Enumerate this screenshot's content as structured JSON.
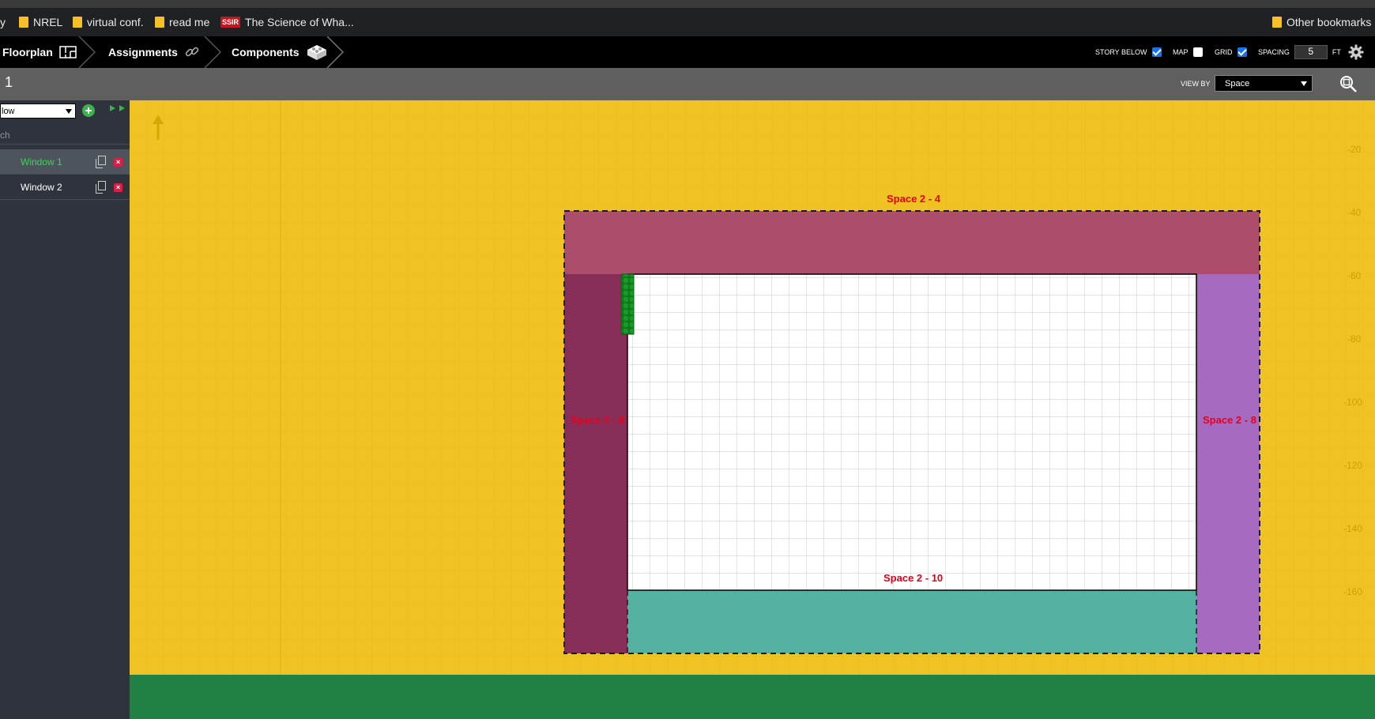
{
  "bookmarks": {
    "items": [
      {
        "label": "y"
      },
      {
        "label": "NREL"
      },
      {
        "label": "virtual conf."
      },
      {
        "label": "read me"
      },
      {
        "label": "The Science of Wha..."
      }
    ],
    "other": "Other bookmarks"
  },
  "toolbar": {
    "tabs": [
      {
        "label": "Floorplan",
        "icon": "floorplan-icon"
      },
      {
        "label": "Assignments",
        "icon": "link-icon"
      },
      {
        "label": "Components",
        "icon": "components-icon"
      }
    ],
    "story_below": {
      "label": "STORY BELOW",
      "checked": true
    },
    "map": {
      "label": "MAP",
      "checked": false
    },
    "grid": {
      "label": "GRID",
      "checked": true
    },
    "spacing": {
      "label": "SPACING",
      "value": "5",
      "unit": "FT"
    },
    "settings_icon": "gear-icon"
  },
  "subbar": {
    "story": "1",
    "view_by_label": "VIEW BY",
    "view_by_value": "Space",
    "zoom_icon": "zoom-icon"
  },
  "sidebar": {
    "type_select": "low",
    "search_placeholder": "ch",
    "items": [
      {
        "label": "Window 1",
        "selected": true
      },
      {
        "label": "Window 2",
        "selected": false
      }
    ]
  },
  "canvas": {
    "spaces": [
      {
        "name": "Space 2 - 4",
        "color": "#ad4d6c"
      },
      {
        "name": "Space 2 - 9",
        "color": "#872f59"
      },
      {
        "name": "Space 2 - 8",
        "color": "#a66ac0"
      },
      {
        "name": "Space 2 - 10",
        "color": "#53b2a1"
      }
    ],
    "axis_ticks": [
      "-20",
      "-40",
      "-60",
      "-80",
      "-100",
      "-120",
      "-140",
      "-160"
    ],
    "colors": {
      "background": "#f0c223",
      "ground": "#238045",
      "window": "#0e7a18"
    }
  }
}
